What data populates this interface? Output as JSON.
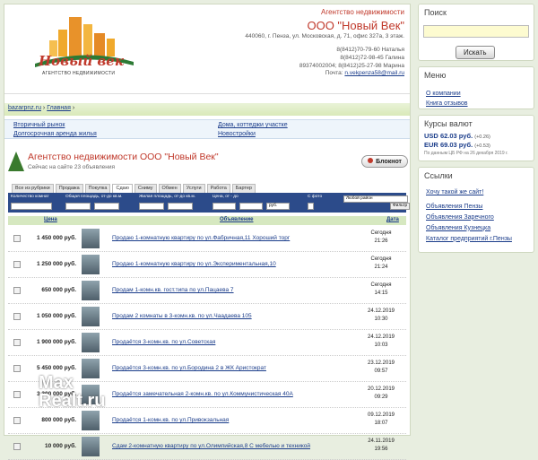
{
  "agency": {
    "heading": "Агентство недвижимости",
    "name": "ООО \"Новый Век\"",
    "address": "440060, г. Пенза, ул. Московская, д. 71, офис 327a, 3 этаж.",
    "phones": [
      "8(8412)70-79-60 Наталья",
      "8(8412)72-98-45 Галина",
      "89374002004; 8(8412)25-27-98 Марина"
    ],
    "mail_label": "Почта:",
    "mail": "n.vekpenza58@mail.ru"
  },
  "logo": {
    "word": "Новый век",
    "sub": "АГЕНТСТВО НЕДВИЖИМОСТИ"
  },
  "crumb": {
    "site": "bazarpnz.ru",
    "page": "Главная"
  },
  "cats": [
    "Вторичный рынок",
    "Долгосрочная аренда жилья",
    "Дома, коттеджи участке",
    "Новостройки"
  ],
  "title": {
    "name": "Агентство недвижимости ООО \"Новый Век\"",
    "online": "Сейчас на сайте 23 объявления",
    "notebook": "Блокнот"
  },
  "tabs": [
    "Все из рубрики",
    "Продажа",
    "Покупка",
    "Сдаю",
    "Сниму",
    "Обмен",
    "Услуги",
    "Работа",
    "Бартер"
  ],
  "filter": {
    "l1": "Количество комнат",
    "l2": "Общая площадь, от-до кв.м.",
    "l3": "Жилая площадь, от-до кв.м.",
    "l4": "Цена, от - до",
    "l5": "С фото",
    "district": "Любой район",
    "cur": "руб.",
    "go": "Фильтр"
  },
  "thead": {
    "price": "Цена",
    "ad": "Объявление",
    "date": "Дата"
  },
  "rows": [
    {
      "price": "1 450 000 руб.",
      "ad": "Продаю 1-комнатную квартиру по ул.Фабричная,11 Хороший торг",
      "d1": "Сегодня",
      "d2": "21:26"
    },
    {
      "price": "1 250 000 руб.",
      "ad": "Продаю 1-комнатную квартиру по ул.Экспериментальная,10",
      "d1": "Сегодня",
      "d2": "21:24"
    },
    {
      "price": "650 000 руб.",
      "ad": "Продам 1-комн.кв. гост.типа по ул.Пацаева 7",
      "d1": "Сегодня",
      "d2": "14:15"
    },
    {
      "price": "1 050 000 руб.",
      "ad": "Продам 2 комнаты в 3-комн.кв. по ул.Чаадаева 105",
      "d1": "24.12.2019",
      "d2": "10:30"
    },
    {
      "price": "1 900 000 руб.",
      "ad": "Продаётся 3-комн.кв. по ул.Советская",
      "d1": "24.12.2019",
      "d2": "10:03"
    },
    {
      "price": "5 450 000 руб.",
      "ad": "Продаётся 3-комн.кв. по ул.Бородина 2 в ЖК Аристократ",
      "d1": "23.12.2019",
      "d2": "09:57"
    },
    {
      "price": "3 300 000 руб.",
      "ad": "Продаётся замечательная 2-комн.кв. по ул.Коммунистическая 40А",
      "d1": "20.12.2019",
      "d2": "09:29"
    },
    {
      "price": "800 000 руб.",
      "ad": "Продаётся 1-комн.кв. по ул.Привокзальная",
      "d1": "09.12.2019",
      "d2": "18:07"
    },
    {
      "price": "10 000 руб.",
      "ad": "Сдам 2-комнатную квартиру по ул.Олимпийская,8 С мебелью и техникой",
      "d1": "24.11.2019",
      "d2": "19:56"
    }
  ],
  "watermark": {
    "a": "Max",
    "b": "Realt.ru"
  },
  "search": {
    "title": "Поиск",
    "btn": "Искать",
    "placeholder": ""
  },
  "menu": {
    "title": "Меню",
    "items": [
      "О компании",
      "Книга отзывов"
    ]
  },
  "rates": {
    "title": "Курсы валют",
    "usd": "USD",
    "usd_v": "62.03 руб.",
    "usd_d": "(+0.26)",
    "eur": "EUR",
    "eur_v": "69.03 руб.",
    "eur_d": "(+0.53)",
    "note": "По данным ЦБ РФ на 26 декабря 2019 г."
  },
  "links": {
    "title": "Ссылки",
    "want": "Хочу такой же сайт!",
    "items": [
      "Объявления Пензы",
      "Объявления Заречного",
      "Объявления Кузнецка",
      "Каталог предприятий г.Пензы"
    ]
  },
  "colors": {
    "accent": "#c0392b",
    "filterbar": "#2c4b8a",
    "sidebar": "#e8eee0"
  }
}
